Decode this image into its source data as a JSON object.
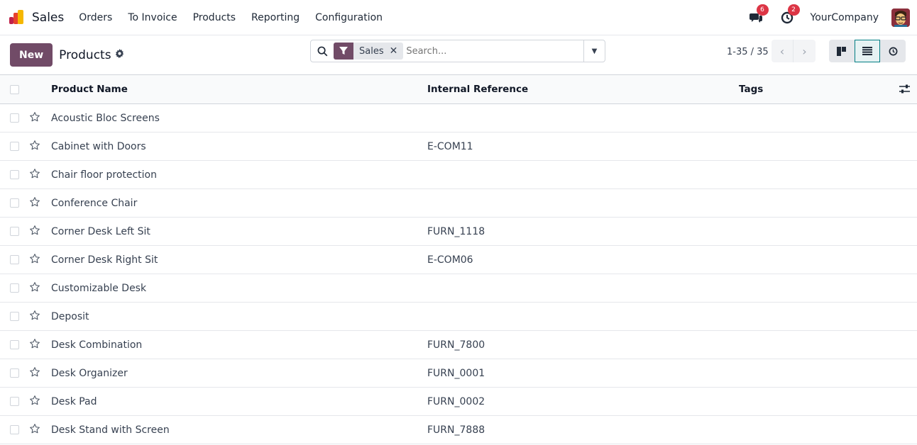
{
  "nav": {
    "app_name": "Sales",
    "menu": [
      "Orders",
      "To Invoice",
      "Products",
      "Reporting",
      "Configuration"
    ],
    "messages_count": "6",
    "activities_count": "2",
    "company": "YourCompany"
  },
  "control": {
    "new_label": "New",
    "breadcrumb": "Products",
    "facet_label": "Sales",
    "search_placeholder": "Search...",
    "pager": "1-35 / 35"
  },
  "table": {
    "headers": {
      "name": "Product Name",
      "ref": "Internal Reference",
      "tags": "Tags"
    },
    "rows": [
      {
        "name": "Acoustic Bloc Screens",
        "ref": ""
      },
      {
        "name": "Cabinet with Doors",
        "ref": "E-COM11"
      },
      {
        "name": "Chair floor protection",
        "ref": ""
      },
      {
        "name": "Conference Chair",
        "ref": ""
      },
      {
        "name": "Corner Desk Left Sit",
        "ref": "FURN_1118"
      },
      {
        "name": "Corner Desk Right Sit",
        "ref": "E-COM06"
      },
      {
        "name": "Customizable Desk",
        "ref": ""
      },
      {
        "name": "Deposit",
        "ref": ""
      },
      {
        "name": "Desk Combination",
        "ref": "FURN_7800"
      },
      {
        "name": "Desk Organizer",
        "ref": "FURN_0001"
      },
      {
        "name": "Desk Pad",
        "ref": "FURN_0002"
      },
      {
        "name": "Desk Stand with Screen",
        "ref": "FURN_7888"
      }
    ]
  },
  "colors": {
    "brand": "#714b67",
    "accent": "#017e84",
    "badge": "#dc3545"
  }
}
